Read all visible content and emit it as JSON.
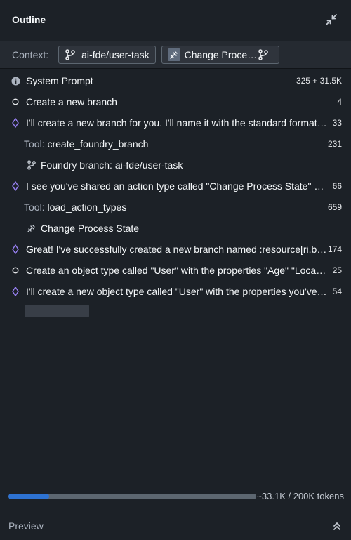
{
  "header": {
    "title": "Outline",
    "collapse_icon": "minimize-icon"
  },
  "context": {
    "label": "Context:",
    "branch_chip": {
      "label": "ai-fde/user-task",
      "icon": "git-branch-icon"
    },
    "action_chip": {
      "label": "Change Process State",
      "icon": "action-type-icon",
      "trailing_icon": "git-branch-icon"
    }
  },
  "outline": {
    "rows": [
      {
        "kind": "system",
        "text": "System Prompt",
        "count": "325 + 31.5K",
        "icon": "info-icon"
      },
      {
        "kind": "user",
        "text": "Create a new branch",
        "count": "4",
        "icon": "circle-icon"
      },
      {
        "kind": "assistant",
        "text": "I'll create a new branch for you. I'll name it with the standard format `ai-fde/user-task` as specified.",
        "count": "33",
        "icon": "diamond-icon"
      },
      {
        "kind": "tool",
        "tool_label": "Tool:",
        "text": "create_foundry_branch",
        "count": "231"
      },
      {
        "kind": "result",
        "text": "Foundry branch: ai-fde/user-task",
        "icon": "git-branch-icon"
      },
      {
        "kind": "assistant",
        "text": "I see you've shared an action type called \"Change Process State\" with the following parameters",
        "count": "66",
        "icon": "diamond-icon"
      },
      {
        "kind": "tool",
        "tool_label": "Tool:",
        "text": "load_action_types",
        "count": "659"
      },
      {
        "kind": "result",
        "text": "Change Process State",
        "icon": "action-type-icon"
      },
      {
        "kind": "assistant",
        "text": "Great! I've successfully created a new branch named :resource[ri.branch...]",
        "count": "174",
        "icon": "diamond-icon"
      },
      {
        "kind": "user",
        "text": "Create an object type called \"User\" with the properties \"Age\" \"Location\" \"Name\"",
        "count": "25",
        "icon": "circle-icon"
      },
      {
        "kind": "assistant",
        "text": "I'll create a new object type called \"User\" with the properties you've requested.",
        "count": "54",
        "icon": "diamond-icon"
      }
    ]
  },
  "progress": {
    "fraction": 0.1655,
    "text": "~33.1K / 200K tokens",
    "color": "#2d72d2"
  },
  "footer": {
    "label": "Preview",
    "icon": "double-chevron-up-icon"
  }
}
